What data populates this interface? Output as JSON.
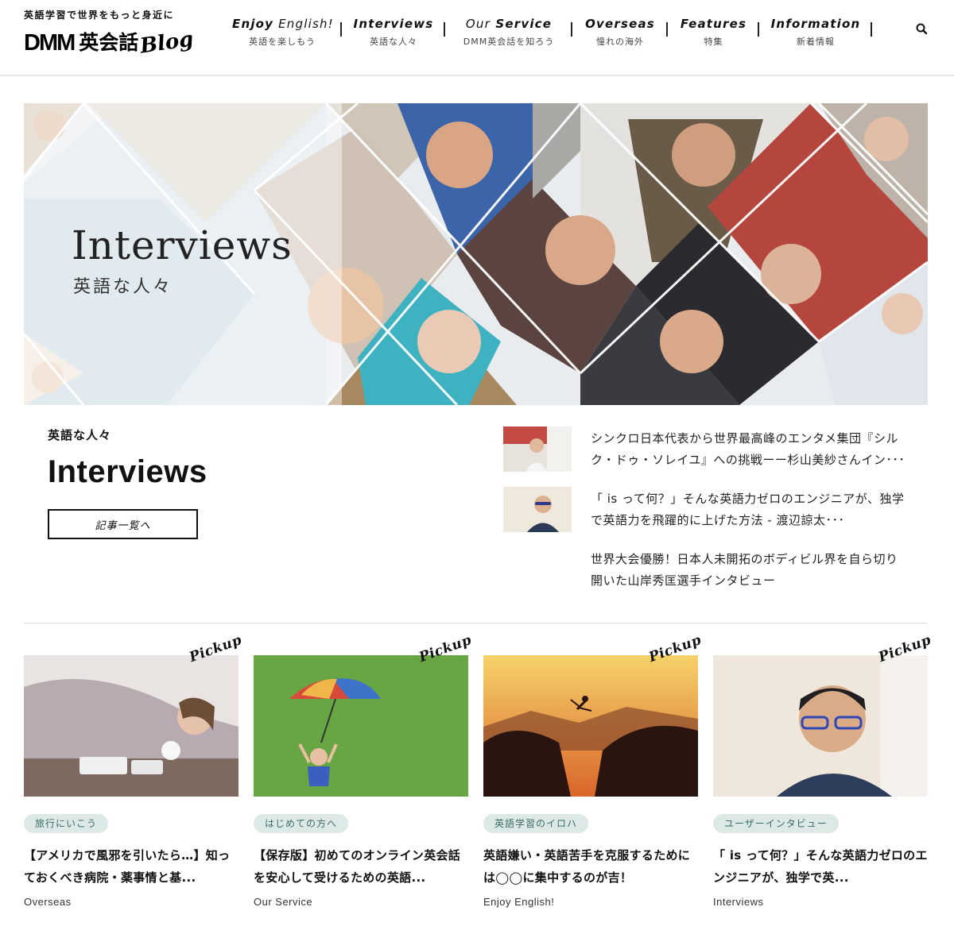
{
  "header": {
    "tagline": "英語学習で世界をもっと身近に",
    "logo_dmm": "DMM",
    "logo_jp": "英会話",
    "logo_blog": "Blog",
    "nav": [
      {
        "en_a": "Enjoy",
        "en_b": " English!",
        "jp": "英語を楽しもう"
      },
      {
        "en_a": "Interviews",
        "en_b": "",
        "jp": "英語な人々"
      },
      {
        "en_a": "Our",
        "en_b": " Service",
        "jp": "DMM英会話を知ろう"
      },
      {
        "en_a": "Overseas",
        "en_b": "",
        "jp": "憧れの海外"
      },
      {
        "en_a": "Features",
        "en_b": "",
        "jp": "特集"
      },
      {
        "en_a": "Information",
        "en_b": "",
        "jp": "新着情報"
      }
    ],
    "search_icon": "search-icon"
  },
  "hero": {
    "title": "Interviews",
    "subtitle": "英語な人々"
  },
  "category": {
    "jp_label": "英語な人々",
    "title": "Interviews",
    "list_button": "記事一覧へ"
  },
  "side_articles": [
    {
      "title": "シンクロ日本代表から世界最高峰のエンタメ集団『シルク・ドゥ・ソレイユ』への挑戦ーー杉山美紗さんイン･･･"
    },
    {
      "title": "「 is って何？」そんな英語力ゼロのエンジニアが、独学で英語力を飛躍的に上げた方法 - 渡辺諒太･･･"
    },
    {
      "title": "世界大会優勝！日本人未開拓のボディビル界を自ら切り開いた山岸秀匡選手インタビュー"
    }
  ],
  "cards": [
    {
      "badge": "Pickup",
      "tag": "旅行にいこう",
      "title": "【アメリカで風邪を引いたら…】知っておくべき病院・薬事情と基...",
      "category": "Overseas"
    },
    {
      "badge": "Pickup",
      "tag": "はじめての方へ",
      "title": "【保存版】初めてのオンライン英会話を安心して受けるための英語...",
      "category": "Our Service"
    },
    {
      "badge": "Pickup",
      "tag": "英語学習のイロハ",
      "title": "英語嫌い・英語苦手を克服するためには◯◯に集中するのが吉！",
      "category": "Enjoy English!"
    },
    {
      "badge": "Pickup",
      "tag": "ユーザーインタビュー",
      "title": "「 is って何？」そんな英語力ゼロのエンジニアが、独学で英...",
      "category": "Interviews"
    }
  ],
  "colors": {
    "tag_bg": "#dce9e6",
    "tag_text": "#3c6b62",
    "divider": "#dddddd"
  }
}
